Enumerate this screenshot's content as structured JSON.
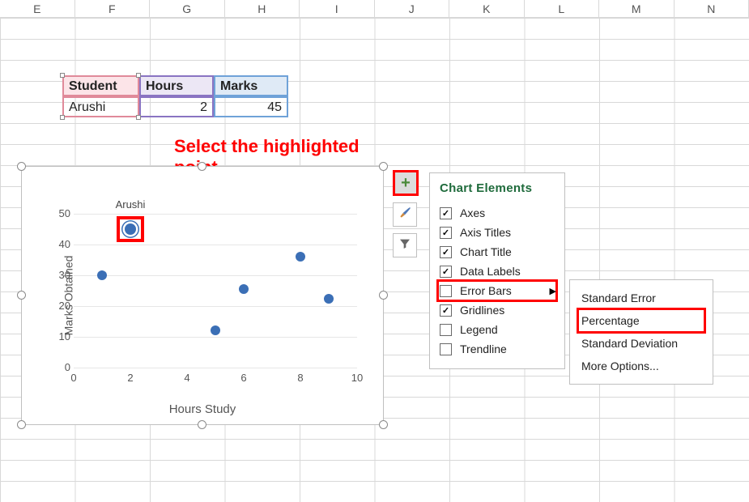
{
  "columns": [
    "E",
    "F",
    "G",
    "H",
    "I",
    "J",
    "K",
    "L",
    "M",
    "N"
  ],
  "table": {
    "headers": {
      "student": "Student",
      "hours": "Hours",
      "marks": "Marks"
    },
    "row": {
      "student": "Arushi",
      "hours": "2",
      "marks": "45"
    }
  },
  "annotation": {
    "line1": "Select the highlighted",
    "line2": "point"
  },
  "chart": {
    "y_title": "Marks Obtained",
    "x_title": "Hours Study",
    "y_ticks": [
      "0",
      "10",
      "20",
      "30",
      "40",
      "50"
    ],
    "x_ticks": [
      "0",
      "2",
      "4",
      "6",
      "8",
      "10"
    ],
    "selected_label": "Arushi"
  },
  "chart_data": {
    "type": "scatter",
    "xlabel": "Hours Study",
    "ylabel": "Marks Obtained",
    "xlim": [
      0,
      10
    ],
    "ylim": [
      0,
      50
    ],
    "series": [
      {
        "name": "Marks",
        "points": [
          {
            "x": 1,
            "y": 30,
            "label": ""
          },
          {
            "x": 2,
            "y": 45,
            "label": "Arushi",
            "selected": true
          },
          {
            "x": 5,
            "y": 12,
            "label": ""
          },
          {
            "x": 6,
            "y": 25.5,
            "label": ""
          },
          {
            "x": 8,
            "y": 36,
            "label": ""
          },
          {
            "x": 9,
            "y": 22.5,
            "label": ""
          }
        ]
      }
    ]
  },
  "chart_elements_panel": {
    "title": "Chart Elements",
    "items": [
      {
        "label": "Axes",
        "checked": true
      },
      {
        "label": "Axis Titles",
        "checked": true
      },
      {
        "label": "Chart Title",
        "checked": true
      },
      {
        "label": "Data Labels",
        "checked": true
      },
      {
        "label": "Error Bars",
        "checked": false,
        "has_submenu": true,
        "highlight": true
      },
      {
        "label": "Gridlines",
        "checked": true
      },
      {
        "label": "Legend",
        "checked": false
      },
      {
        "label": "Trendline",
        "checked": false
      }
    ]
  },
  "error_bars_submenu": {
    "items": [
      {
        "label": "Standard Error"
      },
      {
        "label": "Percentage",
        "highlight": true
      },
      {
        "label": "Standard Deviation"
      },
      {
        "label": "More Options..."
      }
    ]
  }
}
